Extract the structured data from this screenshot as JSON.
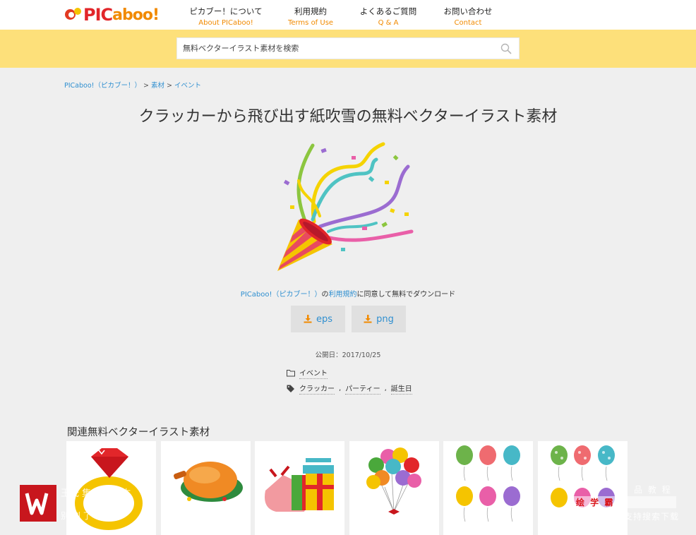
{
  "header": {
    "logo_text": "PICaboo!",
    "logo_pic": "PIC",
    "logo_aboo": "aboo!",
    "nav": [
      {
        "ja": "ピカブー！について",
        "en": "About PICaboo!"
      },
      {
        "ja": "利用規約",
        "en": "Terms of Use"
      },
      {
        "ja": "よくあるご質問",
        "en": "Q & A"
      },
      {
        "ja": "お問い合わせ",
        "en": "Contact"
      }
    ]
  },
  "search": {
    "placeholder": "無料ベクターイラスト素材を検索",
    "icon": "search-icon"
  },
  "breadcrumb": {
    "home": "PICaboo!（ピカブー！）",
    "sep1": " > ",
    "level1": "素材",
    "sep2": " > ",
    "level2": "イベント"
  },
  "page_title": "クラッカーから飛び出す紙吹雪の無料ベクターイラスト素材",
  "agreement": {
    "site": "PICaboo!（ピカブー！）",
    "part1": "の",
    "terms_link": "利用規約",
    "part2": "に同意して無料でダウンロード"
  },
  "downloads": [
    {
      "label": "eps",
      "icon": "download-icon"
    },
    {
      "label": "png",
      "icon": "download-icon"
    }
  ],
  "published": "公開日：2017/10/25",
  "category": {
    "icon": "folder-icon",
    "label": "イベント"
  },
  "tags": {
    "icon": "tag-icon",
    "items": [
      "クラッカー",
      "パーティー",
      "誕生日"
    ],
    "separator": ","
  },
  "related": {
    "title": "関連無料ベクターイラスト素材",
    "items": [
      "ring",
      "roast-chicken",
      "gifts",
      "balloon-bunch",
      "balloons",
      "balloons-pattern"
    ]
  },
  "watermark": {
    "line1": "王氏  集   以人为本",
    "line2": "别  创  了  二",
    "right1": "品 教 程",
    "badge": "绘 学 霸",
    "right2": "支持搜索下载"
  },
  "colors": {
    "accent": "#f18a00",
    "link": "#2f8fd0",
    "search_band": "#fde07a",
    "logo_red": "#e2262a"
  }
}
